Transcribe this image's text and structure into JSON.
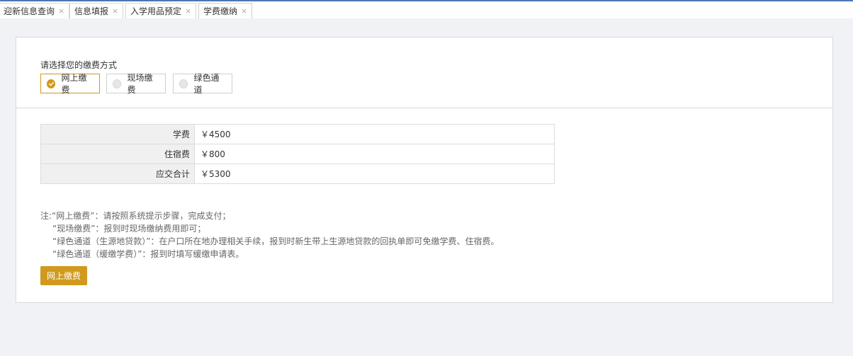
{
  "tabs": [
    {
      "label": "迎新信息查询",
      "close": "×"
    },
    {
      "label": "信息填报",
      "close": "×"
    },
    {
      "label": "入学用品预定",
      "close": "×"
    },
    {
      "label": "学费缴纳",
      "close": "×"
    }
  ],
  "payment": {
    "prompt": "请选择您的缴费方式",
    "options": [
      {
        "label": "网上缴费",
        "selected": true
      },
      {
        "label": "现场缴费",
        "selected": false
      },
      {
        "label": "绿色通道",
        "selected": false
      }
    ]
  },
  "fees": {
    "rows": [
      {
        "label": "学费",
        "value": "￥4500"
      },
      {
        "label": "住宿费",
        "value": "￥800"
      },
      {
        "label": "应交合计",
        "value": "￥5300"
      }
    ]
  },
  "notes": [
    "注:“网上缴费”：请按照系统提示步骤，完成支付；",
    "“现场缴费”：报到时现场缴纳费用即可；",
    "“绿色通道（生源地贷款）”：在户口所在地办理相关手续，报到时新生带上生源地贷款的回执单即可免缴学费、住宿费。",
    "“绿色通道（缓缴学费）”：报到时填写缓缴申请表。"
  ],
  "actions": {
    "pay_label": "网上缴费"
  },
  "colors": {
    "accent": "#d1991d",
    "topline": "#4a77b4"
  }
}
